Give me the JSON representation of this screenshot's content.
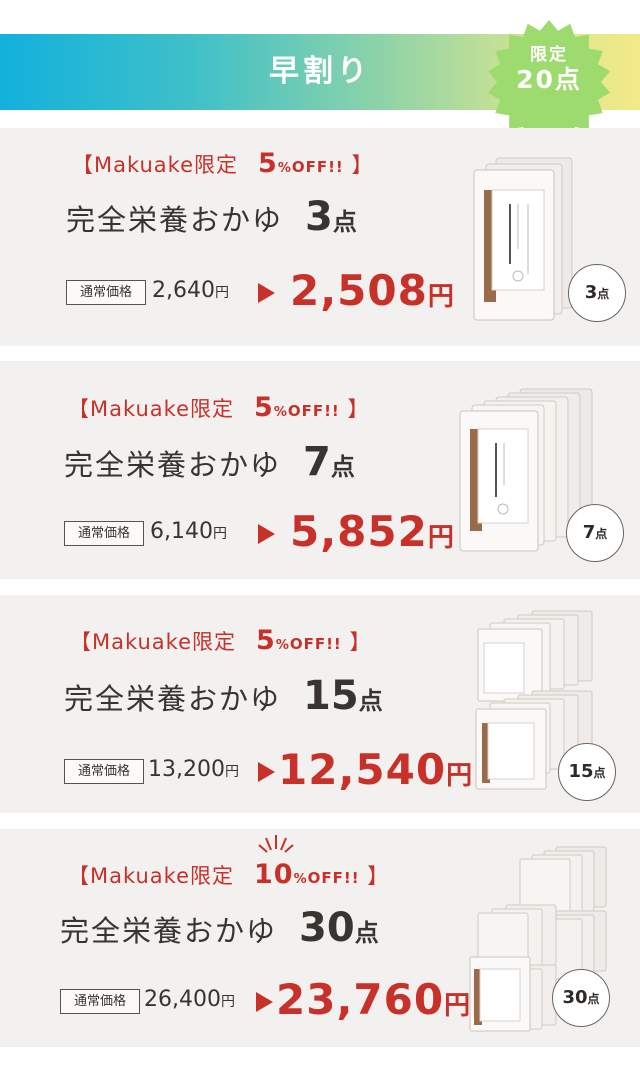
{
  "header": {
    "title": "早割り",
    "badge_line1": "限定",
    "badge_line2": "20点",
    "colors": {
      "gradient_start": "#12b1dc",
      "gradient_end": "#f3ea88",
      "badge": "#9edb6f"
    }
  },
  "plans": [
    {
      "promo_prefix": "【Makuake限定",
      "percent": "5",
      "percent_symbol": "%",
      "off": "OFF!!",
      "promo_suffix": "】",
      "product_name": "完全栄養おかゆ",
      "qty_num": "3",
      "qty_unit": "点",
      "regular_label": "通常価格",
      "regular_price": "2,640",
      "regular_yen": "円",
      "sale_price": "2,508",
      "sale_yen": "円",
      "circle_num": "3",
      "circle_unit": "点"
    },
    {
      "promo_prefix": "【Makuake限定",
      "percent": "5",
      "percent_symbol": "%",
      "off": "OFF!!",
      "promo_suffix": "】",
      "product_name": "完全栄養おかゆ",
      "qty_num": "7",
      "qty_unit": "点",
      "regular_label": "通常価格",
      "regular_price": "6,140",
      "regular_yen": "円",
      "sale_price": "5,852",
      "sale_yen": "円",
      "circle_num": "7",
      "circle_unit": "点"
    },
    {
      "promo_prefix": "【Makuake限定",
      "percent": "5",
      "percent_symbol": "%",
      "off": "OFF!!",
      "promo_suffix": "】",
      "product_name": "完全栄養おかゆ",
      "qty_num": "15",
      "qty_unit": "点",
      "regular_label": "通常価格",
      "regular_price": "13,200",
      "regular_yen": "円",
      "sale_price": "12,540",
      "sale_yen": "円",
      "circle_num": "15",
      "circle_unit": "点"
    },
    {
      "promo_prefix": "【Makuake限定",
      "percent": "10",
      "percent_symbol": "%",
      "off": "OFF!!",
      "promo_suffix": "】",
      "product_name": "完全栄養おかゆ",
      "qty_num": "30",
      "qty_unit": "点",
      "regular_label": "通常価格",
      "regular_price": "26,400",
      "regular_yen": "円",
      "sale_price": "23,760",
      "sale_yen": "円",
      "circle_num": "30",
      "circle_unit": "点"
    }
  ],
  "package": {
    "label_vertical": "完全栄養おかゆ"
  },
  "accent_color": "#c8302a",
  "text_color": "#3a3430",
  "card_bg": "#f3f1ef"
}
